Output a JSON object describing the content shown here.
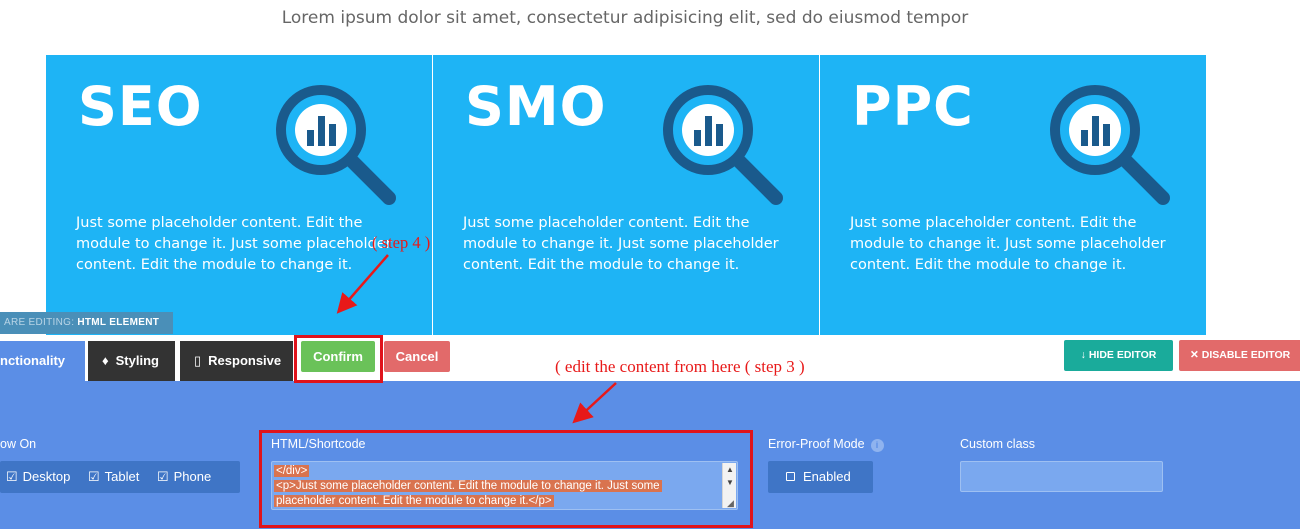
{
  "intro": {
    "text": "Lorem ipsum dolor sit amet, consectetur adipisicing elit, sed do eiusmod tempor"
  },
  "services": [
    {
      "title": "SEO",
      "icon": "magnifier-chart-icon",
      "text": "Just some placeholder content. Edit the module to change it. Just some placeholder content. Edit the module to change it."
    },
    {
      "title": "SMO",
      "icon": "magnifier-chart-icon",
      "text": "Just some placeholder content. Edit the module to change it. Just some placeholder content. Edit the module to change it."
    },
    {
      "title": "PPC",
      "icon": "magnifier-chart-icon",
      "text": "Just some placeholder content. Edit the module to change it. Just some placeholder content. Edit the module to change it."
    }
  ],
  "editing_tag": {
    "prefix": "ARE EDITING:",
    "element": "HTML ELEMENT"
  },
  "toolbar": {
    "tabs": [
      {
        "label": "nctionality",
        "icon": ""
      },
      {
        "label": "Styling",
        "icon": "drop-icon"
      },
      {
        "label": "Responsive",
        "icon": "device-icon"
      }
    ],
    "confirm_label": "Confirm",
    "cancel_label": "Cancel",
    "hide_editor_label": "HIDE EDITOR",
    "disable_editor_label": "DISABLE EDITOR"
  },
  "panel": {
    "show_on": {
      "label": "ow On",
      "options": [
        {
          "label": "Desktop",
          "checked": true
        },
        {
          "label": "Tablet",
          "checked": true
        },
        {
          "label": "Phone",
          "checked": true
        }
      ]
    },
    "html_shortcode": {
      "label": "HTML/Shortcode",
      "lines": [
        "</div>",
        "<p>Just some placeholder content. Edit the module to change it. Just some",
        "placeholder content. Edit the module to change it.</p>"
      ]
    },
    "error_proof": {
      "label": "Error-Proof Mode",
      "button_label": "Enabled"
    },
    "custom_class": {
      "label": "Custom class",
      "value": ""
    }
  },
  "annotations": {
    "step4": "( step 4 )",
    "step3": "( edit the content from here ( step 3 )"
  },
  "colors": {
    "service_bg": "#1eb4f5",
    "icon_dark": "#1a5a8c",
    "panel_bg": "#5b8ee6",
    "confirm_green": "#6ac259",
    "cancel_red": "#e26a6a",
    "hide_teal": "#1aab9b",
    "annotation_red": "#e81919"
  }
}
